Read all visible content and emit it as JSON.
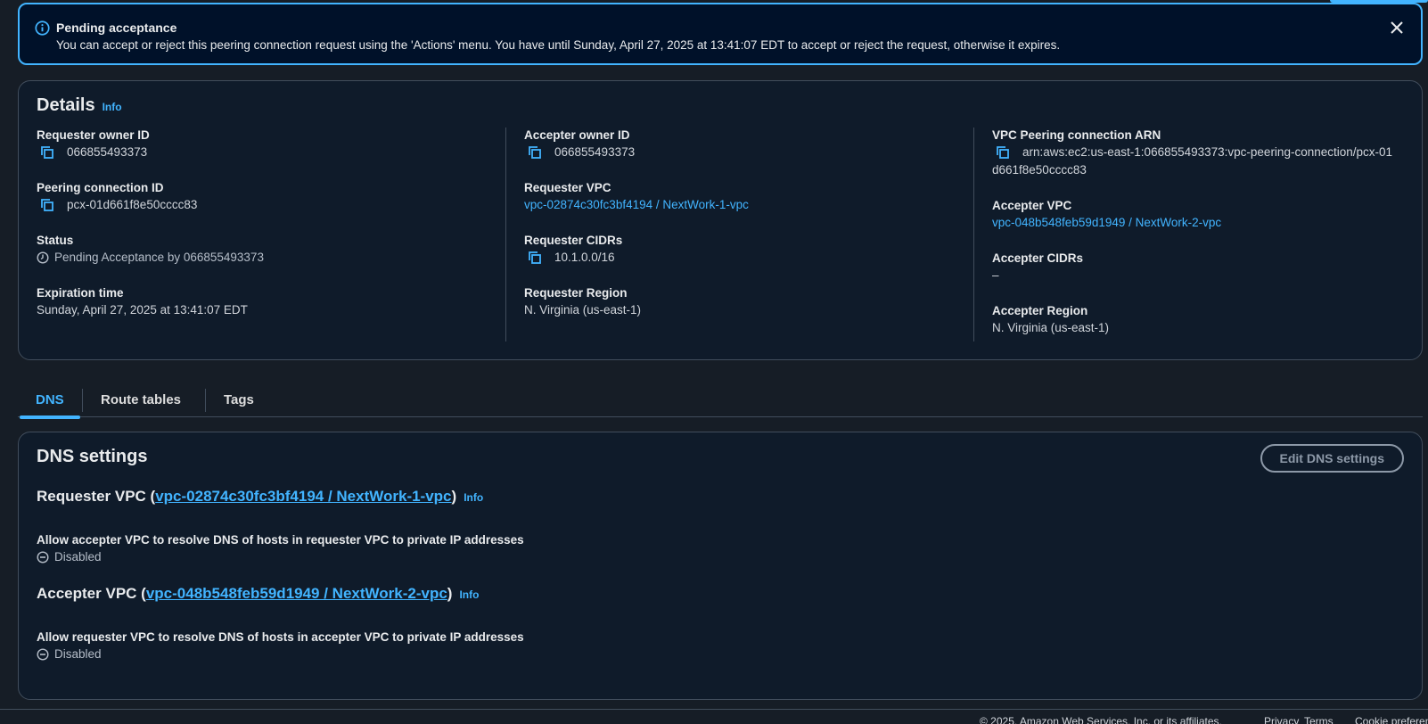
{
  "flash": {
    "title": "Pending acceptance",
    "message": "You can accept or reject this peering connection request using the 'Actions' menu. You have until Sunday, April 27, 2025 at 13:41:07 EDT to accept or reject the request, otherwise it expires."
  },
  "details": {
    "title": "Details",
    "info": "Info",
    "requester_owner_id": {
      "label": "Requester owner ID",
      "value": "066855493373"
    },
    "peering_connection_id": {
      "label": "Peering connection ID",
      "value": "pcx-01d661f8e50cccc83"
    },
    "status": {
      "label": "Status",
      "value": "Pending Acceptance by 066855493373"
    },
    "expiration_time": {
      "label": "Expiration time",
      "value": "Sunday, April 27, 2025 at 13:41:07 EDT"
    },
    "accepter_owner_id": {
      "label": "Accepter owner ID",
      "value": "066855493373"
    },
    "requester_vpc": {
      "label": "Requester VPC",
      "value": "vpc-02874c30fc3bf4194 / NextWork-1-vpc"
    },
    "requester_cidrs": {
      "label": "Requester CIDRs",
      "value": "10.1.0.0/16"
    },
    "requester_region": {
      "label": "Requester Region",
      "value": "N. Virginia (us-east-1)"
    },
    "arn": {
      "label": "VPC Peering connection ARN",
      "value": "arn:aws:ec2:us-east-1:066855493373:vpc-peering-connection/pcx-01d661f8e50cccc83"
    },
    "accepter_vpc": {
      "label": "Accepter VPC",
      "value": "vpc-048b548feb59d1949 / NextWork-2-vpc"
    },
    "accepter_cidrs": {
      "label": "Accepter CIDRs",
      "value": "–"
    },
    "accepter_region": {
      "label": "Accepter Region",
      "value": "N. Virginia (us-east-1)"
    }
  },
  "tabs": [
    "DNS",
    "Route tables",
    "Tags"
  ],
  "dns": {
    "title": "DNS settings",
    "edit_button": "Edit DNS settings",
    "requester": {
      "prefix": "Requester VPC (",
      "link": "vpc-02874c30fc3bf4194 / NextWork-1-vpc",
      "suffix": ")",
      "info": "Info",
      "setting_label": "Allow accepter VPC to resolve DNS of hosts in requester VPC to private IP addresses",
      "setting_value": "Disabled"
    },
    "accepter": {
      "prefix": "Accepter VPC (",
      "link": "vpc-048b548feb59d1949 / NextWork-2-vpc",
      "suffix": ")",
      "info": "Info",
      "setting_label": "Allow requester VPC to resolve DNS of hosts in accepter VPC to private IP addresses",
      "setting_value": "Disabled"
    }
  },
  "footer": {
    "copyright": "© 2025, Amazon Web Services, Inc. or its affiliates.",
    "privacy": "Privacy",
    "terms": "Terms",
    "cookie": "Cookie preferen"
  },
  "colors": {
    "accent": "#42b4ff",
    "background": "#161d26",
    "panel": "#0f1b2a"
  }
}
